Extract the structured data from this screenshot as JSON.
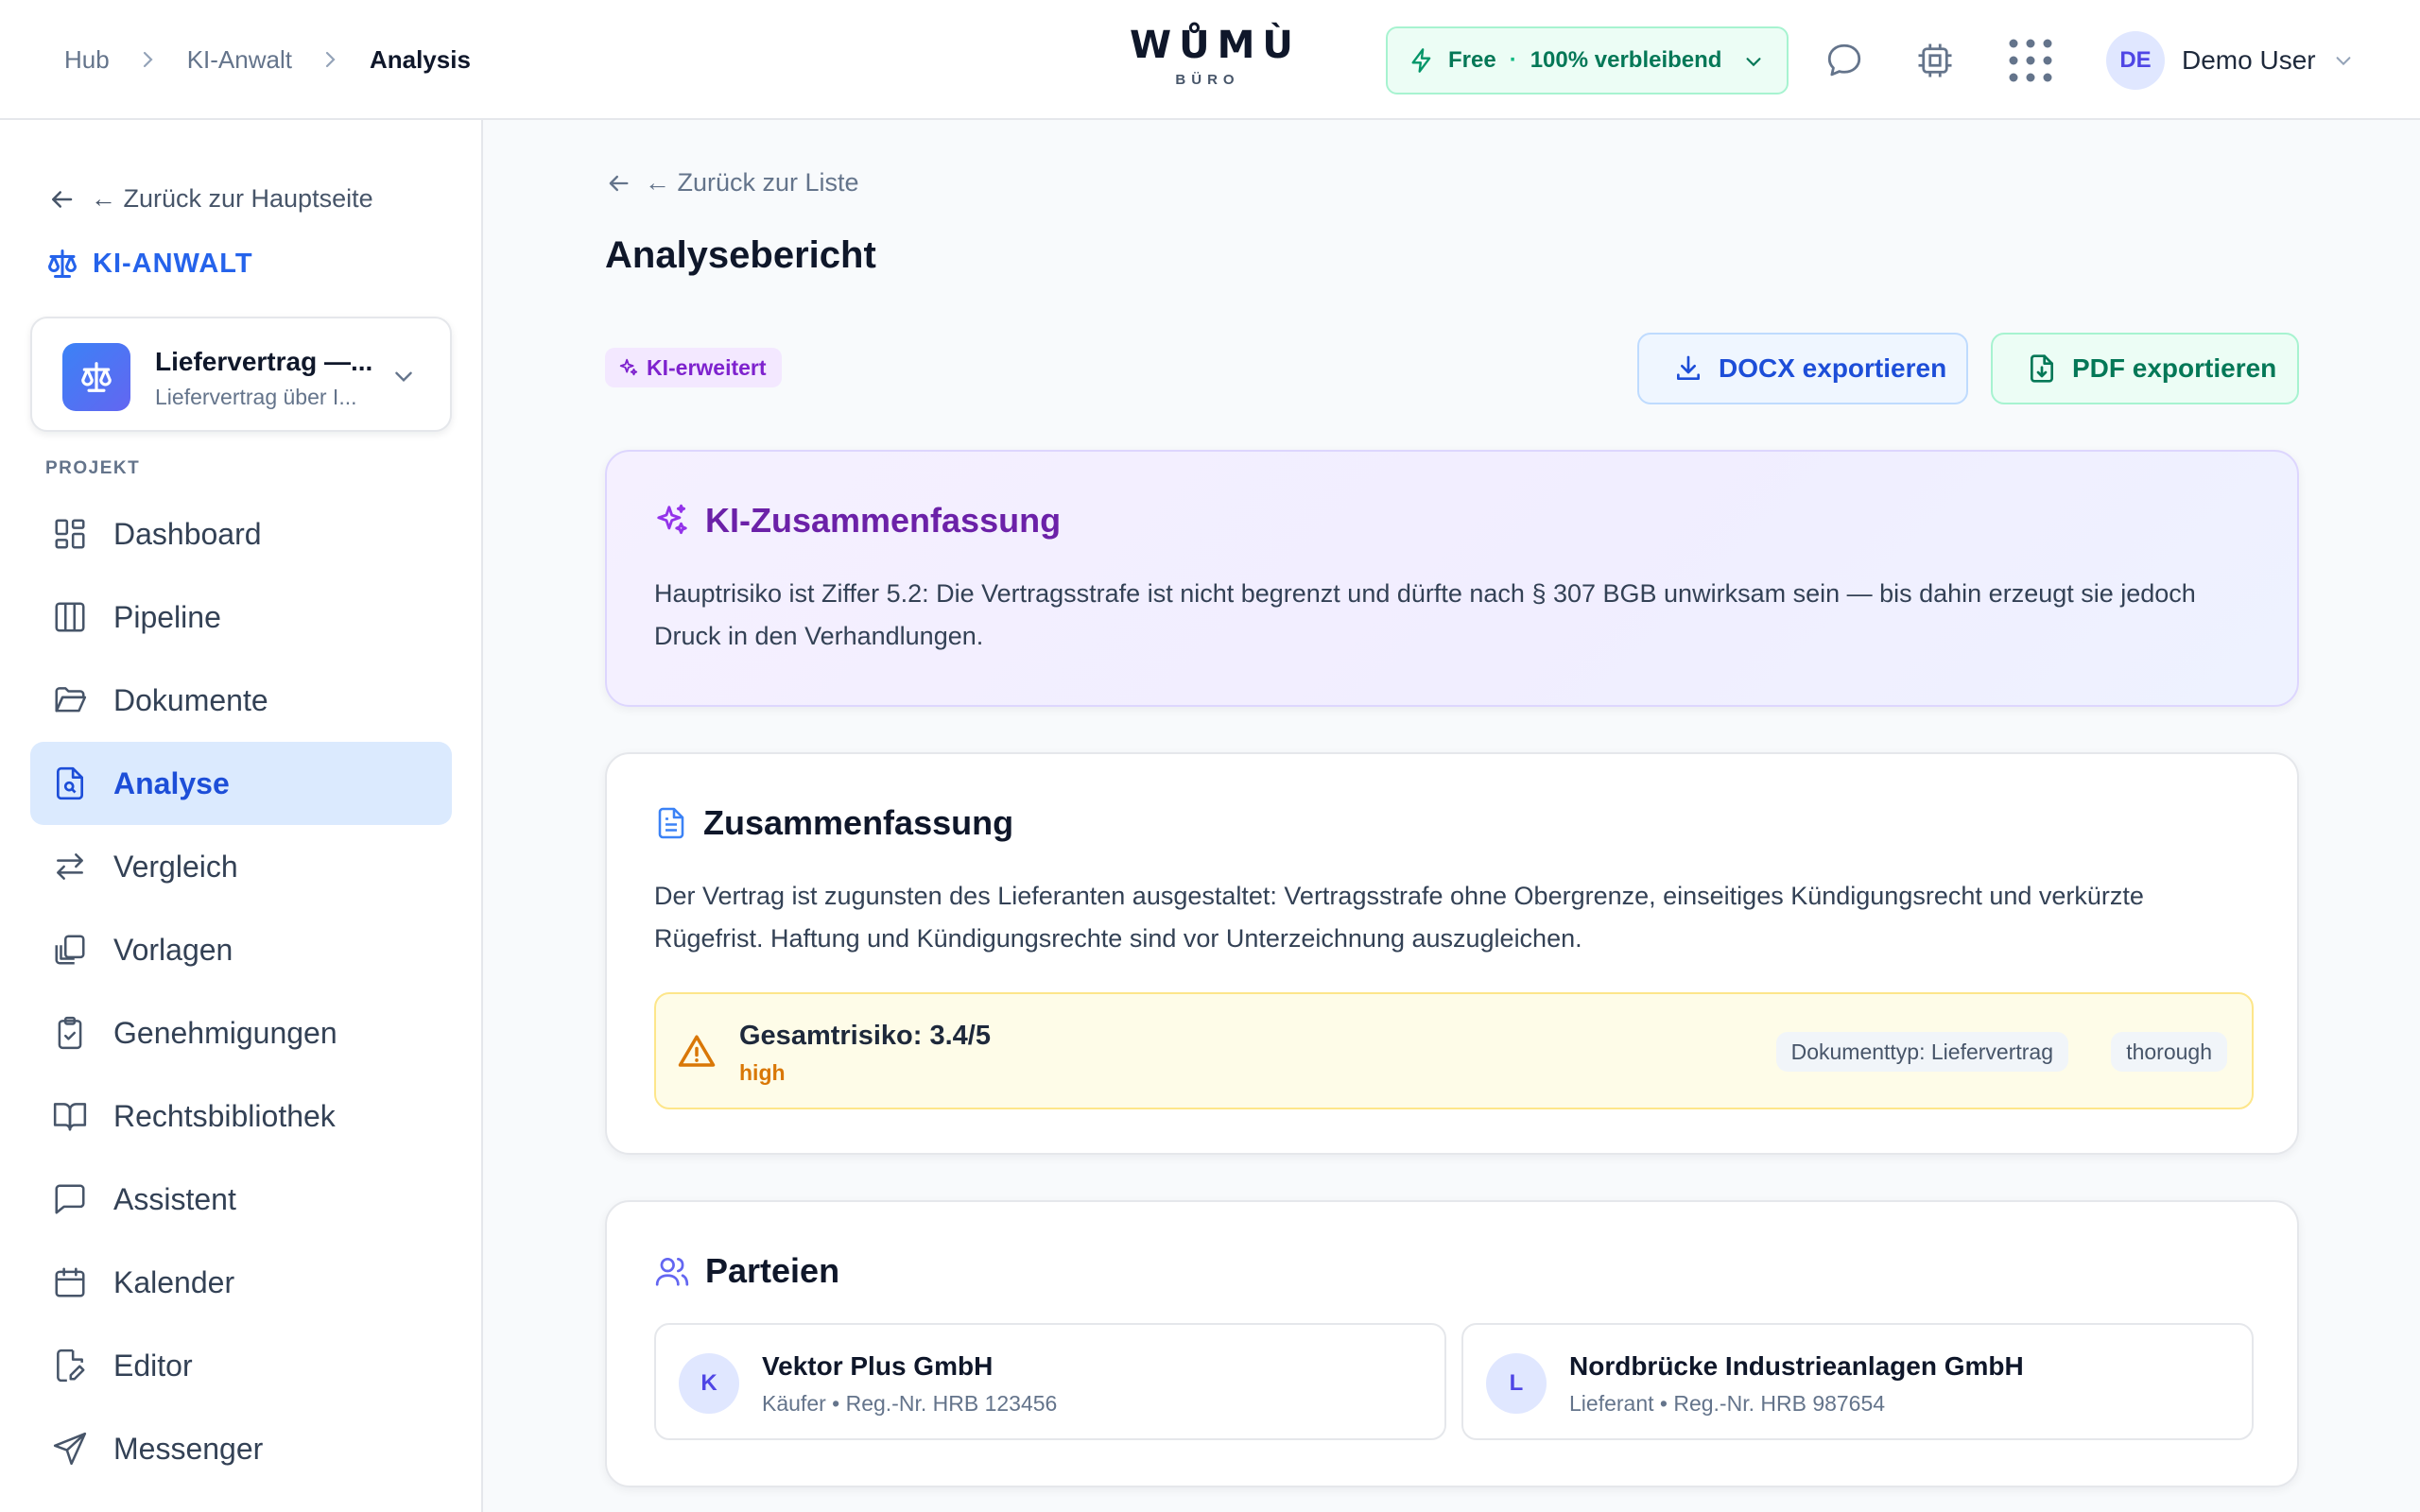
{
  "breadcrumb": {
    "items": [
      "Hub",
      "KI-Anwalt"
    ],
    "current": "Analysis"
  },
  "logo": {
    "main": "WŮMÙ",
    "sub": "BÜRO"
  },
  "plan": {
    "tier": "Free",
    "separator": "·",
    "remaining": "100% verbleibend"
  },
  "header_icons": [
    "chat-bubble-icon",
    "cpu-icon",
    "apps-grid-icon"
  ],
  "user": {
    "initials": "DE",
    "name": "Demo User"
  },
  "sidebar": {
    "back_label": "← Zurück zur Hauptseite",
    "brand": "KI-ANWALT",
    "project": {
      "title": "Liefervertrag —...",
      "subtitle": "Liefervertrag über I..."
    },
    "section_label": "PROJEKT",
    "items": [
      {
        "label": "Dashboard",
        "icon": "dashboard-icon"
      },
      {
        "label": "Pipeline",
        "icon": "pipeline-icon"
      },
      {
        "label": "Dokumente",
        "icon": "folder-icon"
      },
      {
        "label": "Analyse",
        "icon": "file-search-icon",
        "active": true
      },
      {
        "label": "Vergleich",
        "icon": "compare-icon"
      },
      {
        "label": "Vorlagen",
        "icon": "templates-icon"
      },
      {
        "label": "Genehmigungen",
        "icon": "clipboard-check-icon"
      },
      {
        "label": "Rechtsbibliothek",
        "icon": "book-icon"
      },
      {
        "label": "Assistent",
        "icon": "message-icon"
      },
      {
        "label": "Kalender",
        "icon": "calendar-icon"
      },
      {
        "label": "Editor",
        "icon": "edit-file-icon"
      },
      {
        "label": "Messenger",
        "icon": "send-icon"
      }
    ]
  },
  "main": {
    "back_label": "← Zurück zur Liste",
    "title": "Analysebericht",
    "ai_badge": "KI-erweitert",
    "export_docx": "DOCX exportieren",
    "export_pdf": "PDF exportieren",
    "ai_summary": {
      "title": "KI-Zusammenfassung",
      "text": "Hauptrisiko ist Ziffer 5.2: Die Vertragsstrafe ist nicht begrenzt und dürfte nach § 307 BGB unwirksam sein — bis dahin erzeugt sie jedoch Druck in den Verhandlungen."
    },
    "summary": {
      "title": "Zusammenfassung",
      "text": "Der Vertrag ist zugunsten des Lieferanten ausgestaltet: Vertragsstrafe ohne Obergrenze, einseitiges Kündigungsrecht und verkürzte Rügefrist. Haftung und Kündigungsrechte sind vor Unterzeichnung auszugleichen.",
      "risk_title": "Gesamtrisiko: 3.4/5",
      "risk_level": "high",
      "doc_type": "Dokumenttyp: Liefervertrag",
      "depth": "thorough"
    },
    "parties": {
      "title": "Parteien",
      "items": [
        {
          "initial": "K",
          "name": "Vektor Plus GmbH",
          "detail": "Käufer • Reg.-Nr. HRB 123456"
        },
        {
          "initial": "L",
          "name": "Nordbrücke Industrieanlagen GmbH",
          "detail": "Lieferant • Reg.-Nr. HRB 987654"
        }
      ]
    }
  },
  "colors": {
    "accent": "#2563eb",
    "ai_purple": "#6b21a8",
    "success": "#047857",
    "warning": "#d97706"
  }
}
